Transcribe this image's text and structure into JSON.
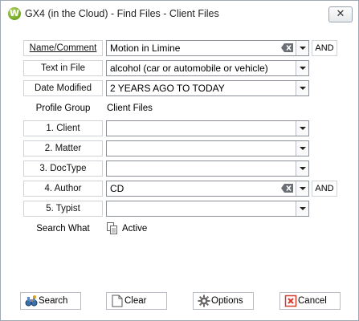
{
  "window": {
    "title": "GX4 (in the Cloud) - Find Files - Client Files",
    "logo_letter": "W",
    "close_glyph": "✕"
  },
  "fields": {
    "name_comment": {
      "label": "Name/Comment",
      "value": "Motion in Limine",
      "and": "AND"
    },
    "text_in_file": {
      "label": "Text in File",
      "value": "alcohol (car or automobile or vehicle)"
    },
    "date_modified": {
      "label": "Date Modified",
      "value": "2 YEARS AGO TO TODAY"
    },
    "profile_group": {
      "label": "Profile Group",
      "value": "Client Files"
    },
    "client": {
      "label": "1. Client",
      "value": ""
    },
    "matter": {
      "label": "2. Matter",
      "value": ""
    },
    "doctype": {
      "label": "3. DocType",
      "value": ""
    },
    "author": {
      "label": "4. Author",
      "value": "CD",
      "and": "AND"
    },
    "typist": {
      "label": "5. Typist",
      "value": ""
    },
    "search_what": {
      "label": "Search What",
      "value": "Active"
    }
  },
  "buttons": {
    "search": "Search",
    "clear": "Clear",
    "options": "Options",
    "cancel": "Cancel"
  },
  "icons": {
    "clear_field": "backspace-x-icon",
    "dropdown": "chevron-down-icon",
    "search": "search-binoculars-icon",
    "clear": "clear-page-icon",
    "options": "gear-icon",
    "cancel": "cancel-x-icon",
    "active": "documents-icon"
  },
  "colors": {
    "logo_green": "#6ea51f",
    "cancel_red": "#d23a2a"
  }
}
